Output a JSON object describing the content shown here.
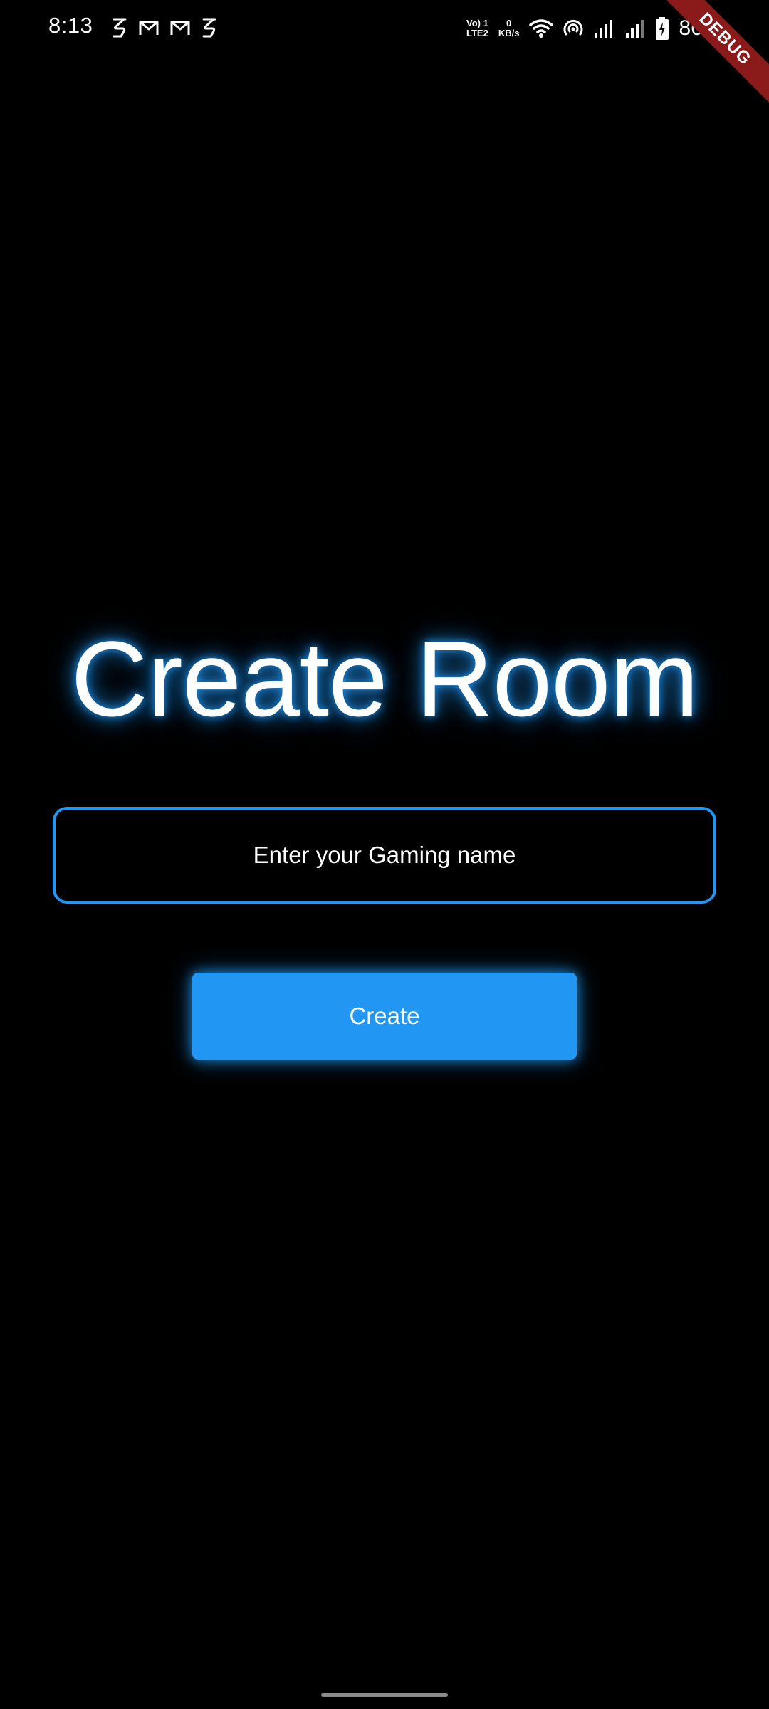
{
  "status_bar": {
    "time": "8:13",
    "notification_icons": [
      "s-app-icon",
      "gmail-icon",
      "gmail-icon",
      "s-app-icon"
    ],
    "volte_line1": "Vo) 1",
    "volte_line2": "LTE2",
    "speed_value": "0",
    "speed_unit": "KB/s",
    "battery_percent": "86%"
  },
  "debug_banner": "DEBUG",
  "screen": {
    "title": "Create Room",
    "name_field": {
      "placeholder": "Enter your Gaming name",
      "value": ""
    },
    "create_button_label": "Create"
  },
  "colors": {
    "background": "#000000",
    "accent": "#2196f3",
    "text": "#ffffff",
    "debug_ribbon": "#8b1a1a"
  }
}
